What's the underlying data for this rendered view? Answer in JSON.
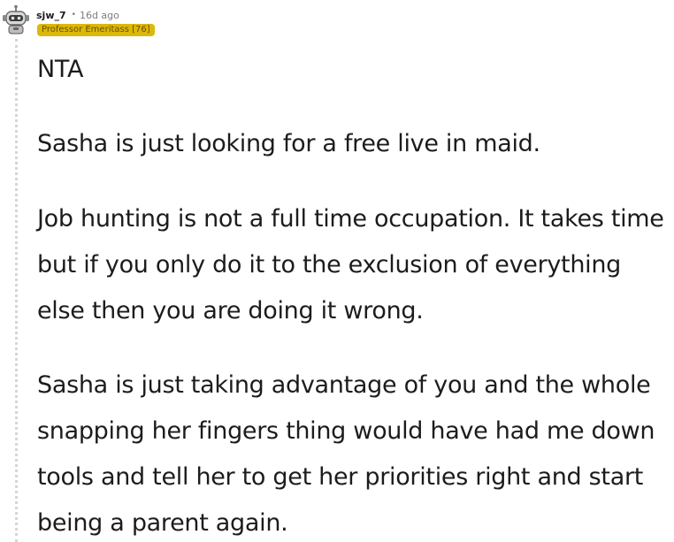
{
  "comment": {
    "author": "sjw_7",
    "separator": "•",
    "age": "16d ago",
    "flair": "Professor Emeritass [76]",
    "paragraphs": [
      "NTA",
      "Sasha is just looking for a free live in maid.",
      "Job hunting is not a full time occupation. It takes time but if you only do it to the exclusion of everything else then you are doing it wrong.",
      "Sasha is just taking advantage of you and the whole snapping her fingers thing would have had me down tools and tell her to get her priorities right and start being a parent again."
    ]
  },
  "colors": {
    "flair_background": "#dcb809",
    "text": "#1c1c1c",
    "muted": "#7c7c7c",
    "thread_line": "#d6d6d6"
  },
  "icons": {
    "avatar": "robot-avatar-icon"
  }
}
